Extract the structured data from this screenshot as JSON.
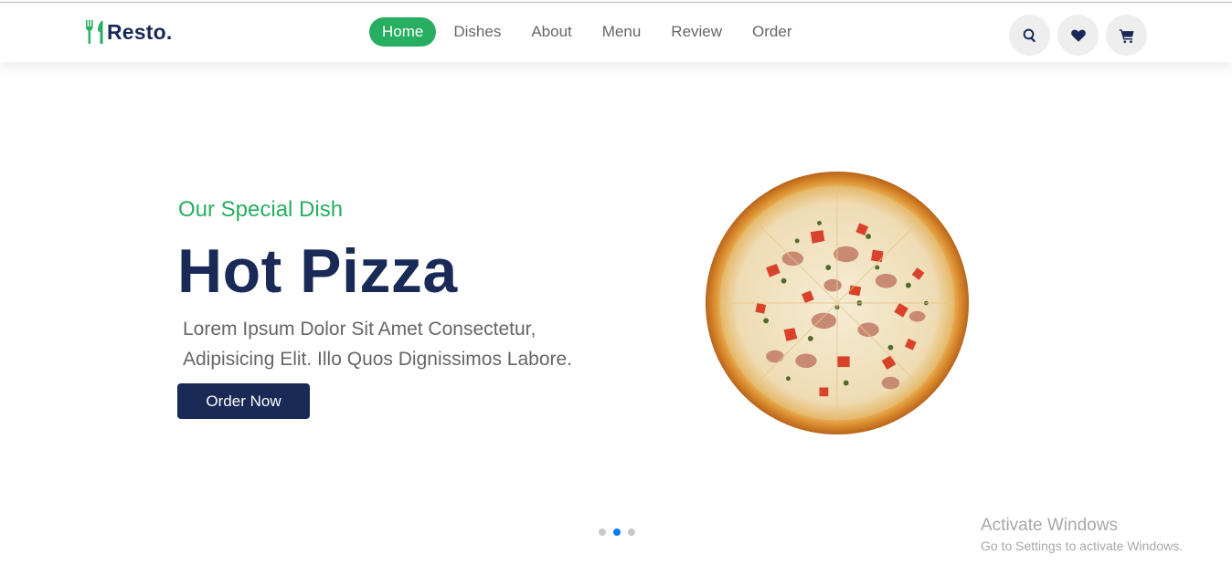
{
  "header": {
    "logo_text": "Resto.",
    "nav": [
      {
        "label": "Home",
        "active": true
      },
      {
        "label": "Dishes",
        "active": false
      },
      {
        "label": "About",
        "active": false
      },
      {
        "label": "Menu",
        "active": false
      },
      {
        "label": "Review",
        "active": false
      },
      {
        "label": "Order",
        "active": false
      }
    ],
    "icons": [
      "search-icon",
      "heart-icon",
      "cart-icon"
    ]
  },
  "hero": {
    "subtitle": "Our Special Dish",
    "title": "Hot Pizza",
    "description": "Lorem Ipsum Dolor Sit Amet Consectetur, Adipisicing Elit. Illo Quos Dignissimos Labore.",
    "button_label": "Order Now"
  },
  "slider": {
    "count": 3,
    "active_index": 1
  },
  "watermark": {
    "line1": "Activate Windows",
    "line2": "Go to Settings to activate Windows."
  },
  "colors": {
    "brand": "#192a56",
    "accent": "#27ae60",
    "dot_active": "#007aff"
  }
}
